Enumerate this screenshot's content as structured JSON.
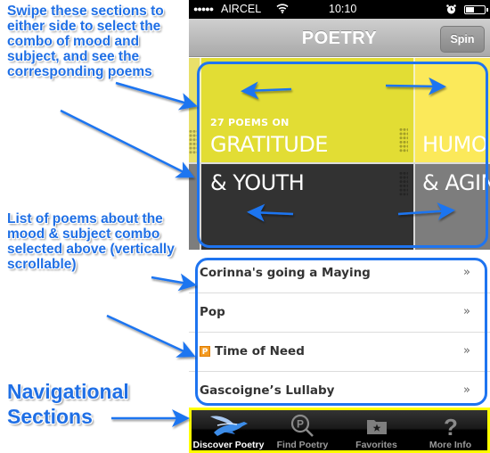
{
  "annotations": {
    "swipe_note": "Swipe these sections to either side to select the combo of mood and subject, and see the corresponding poems",
    "list_note": "List of poems about the mood & subject combo selected above (vertically scrollable)",
    "nav_note": "Navigational Sections",
    "colors": {
      "annotation_blue": "#1f6fe5",
      "highlight_blue": "#1e74f0",
      "nav_highlight": "#ffff00"
    }
  },
  "status_bar": {
    "signal": "●●●●●",
    "carrier": "AIRCEL",
    "wifi_icon": "wifi-icon",
    "time": "10:10",
    "alarm_icon": "alarm-icon",
    "battery_level": 0.45
  },
  "nav_bar": {
    "title": "POETRY",
    "spin_label": "Spin"
  },
  "mood_wheel": {
    "count_label": "27 POEMS ON",
    "cards": [
      {
        "label": "GRATITUDE",
        "color": "#e2dd34",
        "selected": true
      },
      {
        "label": "HUMO",
        "color": "#fbe95a",
        "selected": false
      }
    ]
  },
  "subject_wheel": {
    "cards": [
      {
        "label": "& YOUTH",
        "color": "#323232",
        "selected": true
      },
      {
        "label": "& AGIN",
        "color": "#7d7d7d",
        "selected": false
      }
    ]
  },
  "poem_list": {
    "items": [
      {
        "title": "Corinna's going a Maying",
        "badge": ""
      },
      {
        "title": "Pop",
        "badge": ""
      },
      {
        "title": "Time of Need",
        "badge": "P"
      },
      {
        "title": "Gascoigne’s Lullaby",
        "badge": ""
      }
    ],
    "chevron": "»"
  },
  "tab_bar": {
    "tabs": [
      {
        "label": "Discover Poetry",
        "icon": "bird-icon",
        "active": true
      },
      {
        "label": "Find Poetry",
        "icon": "poem-search-icon",
        "active": false
      },
      {
        "label": "Favorites",
        "icon": "star-folder-icon",
        "active": false
      },
      {
        "label": "More Info",
        "icon": "question-icon",
        "active": false
      }
    ]
  }
}
